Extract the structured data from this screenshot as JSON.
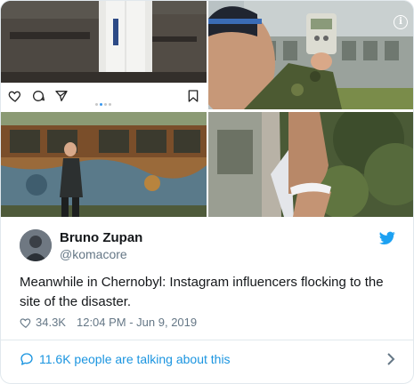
{
  "tweet": {
    "author_name": "Bruno Zupan",
    "author_handle": "@komacore",
    "text": "Meanwhile in Chernobyl: Instagram influencers flocking to the site of the disaster.",
    "likes": "34.3K",
    "timestamp": "12:04 PM - Jun 9, 2019",
    "conversation": "11.6K people are talking about this"
  },
  "colors": {
    "link_blue": "#1b95e0",
    "twitter_blue": "#1da1f2",
    "meta_gray": "#657786",
    "text_dark": "#14171a",
    "divider": "#e1e8ed"
  },
  "icons": {
    "instagram_like": "heart-outline-icon",
    "instagram_comment": "comment-icon",
    "instagram_share": "paper-plane-icon",
    "instagram_save": "bookmark-icon",
    "photo_info": "info-icon",
    "twitter_logo": "twitter-bird-icon",
    "like": "heart-outline-icon",
    "conversation": "speech-bubble-icon",
    "chevron": "chevron-right-icon"
  }
}
